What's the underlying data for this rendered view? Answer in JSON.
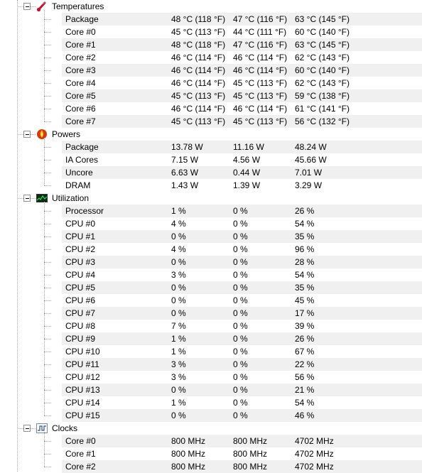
{
  "sections": [
    {
      "name": "Temperatures",
      "icon": "temperature-icon",
      "rows": [
        {
          "label": "Package",
          "current": "48 °C  (118 °F)",
          "min": "47 °C  (116 °F)",
          "max": "63 °C  (145 °F)"
        },
        {
          "label": "Core #0",
          "current": "45 °C  (113 °F)",
          "min": "44 °C  (111 °F)",
          "max": "60 °C  (140 °F)"
        },
        {
          "label": "Core #1",
          "current": "48 °C  (118 °F)",
          "min": "47 °C  (116 °F)",
          "max": "63 °C  (145 °F)"
        },
        {
          "label": "Core #2",
          "current": "46 °C  (114 °F)",
          "min": "46 °C  (114 °F)",
          "max": "62 °C  (143 °F)"
        },
        {
          "label": "Core #3",
          "current": "46 °C  (114 °F)",
          "min": "46 °C  (114 °F)",
          "max": "60 °C  (140 °F)"
        },
        {
          "label": "Core #4",
          "current": "46 °C  (114 °F)",
          "min": "45 °C  (113 °F)",
          "max": "62 °C  (143 °F)"
        },
        {
          "label": "Core #5",
          "current": "45 °C  (113 °F)",
          "min": "45 °C  (113 °F)",
          "max": "59 °C  (138 °F)"
        },
        {
          "label": "Core #6",
          "current": "46 °C  (114 °F)",
          "min": "46 °C  (114 °F)",
          "max": "61 °C  (141 °F)"
        },
        {
          "label": "Core #7",
          "current": "45 °C  (113 °F)",
          "min": "45 °C  (113 °F)",
          "max": "56 °C  (132 °F)"
        }
      ]
    },
    {
      "name": "Powers",
      "icon": "power-flame-icon",
      "rows": [
        {
          "label": "Package",
          "current": "13.78 W",
          "min": "11.16 W",
          "max": "48.24 W"
        },
        {
          "label": "IA Cores",
          "current": "7.15 W",
          "min": "4.56 W",
          "max": "45.66 W"
        },
        {
          "label": "Uncore",
          "current": "6.63 W",
          "min": "0.44 W",
          "max": "7.01 W"
        },
        {
          "label": "DRAM",
          "current": "1.43 W",
          "min": "1.39 W",
          "max": "3.29 W"
        }
      ]
    },
    {
      "name": "Utilization",
      "icon": "utilization-graph-icon",
      "rows": [
        {
          "label": "Processor",
          "current": "1 %",
          "min": "0 %",
          "max": "26 %"
        },
        {
          "label": "CPU #0",
          "current": "4 %",
          "min": "0 %",
          "max": "54 %"
        },
        {
          "label": "CPU #1",
          "current": "0 %",
          "min": "0 %",
          "max": "35 %"
        },
        {
          "label": "CPU #2",
          "current": "4 %",
          "min": "0 %",
          "max": "96 %"
        },
        {
          "label": "CPU #3",
          "current": "0 %",
          "min": "0 %",
          "max": "28 %"
        },
        {
          "label": "CPU #4",
          "current": "3 %",
          "min": "0 %",
          "max": "54 %"
        },
        {
          "label": "CPU #5",
          "current": "0 %",
          "min": "0 %",
          "max": "35 %"
        },
        {
          "label": "CPU #6",
          "current": "0 %",
          "min": "0 %",
          "max": "45 %"
        },
        {
          "label": "CPU #7",
          "current": "0 %",
          "min": "0 %",
          "max": "17 %"
        },
        {
          "label": "CPU #8",
          "current": "7 %",
          "min": "0 %",
          "max": "39 %"
        },
        {
          "label": "CPU #9",
          "current": "1 %",
          "min": "0 %",
          "max": "26 %"
        },
        {
          "label": "CPU #10",
          "current": "1 %",
          "min": "0 %",
          "max": "67 %"
        },
        {
          "label": "CPU #11",
          "current": "3 %",
          "min": "0 %",
          "max": "22 %"
        },
        {
          "label": "CPU #12",
          "current": "3 %",
          "min": "0 %",
          "max": "56 %"
        },
        {
          "label": "CPU #13",
          "current": "0 %",
          "min": "0 %",
          "max": "21 %"
        },
        {
          "label": "CPU #14",
          "current": "1 %",
          "min": "0 %",
          "max": "54 %"
        },
        {
          "label": "CPU #15",
          "current": "0 %",
          "min": "0 %",
          "max": "46 %"
        }
      ]
    },
    {
      "name": "Clocks",
      "icon": "clock-waveform-icon",
      "rows": [
        {
          "label": "Core #0",
          "current": "800 MHz",
          "min": "800 MHz",
          "max": "4702 MHz"
        },
        {
          "label": "Core #1",
          "current": "800 MHz",
          "min": "800 MHz",
          "max": "4702 MHz"
        },
        {
          "label": "Core #2",
          "current": "800 MHz",
          "min": "800 MHz",
          "max": "4702 MHz"
        }
      ]
    }
  ],
  "colors": {
    "alt_row_bg": "#f0f0f0",
    "tree_line": "#a0a0a0",
    "expander_border": "#919191"
  }
}
